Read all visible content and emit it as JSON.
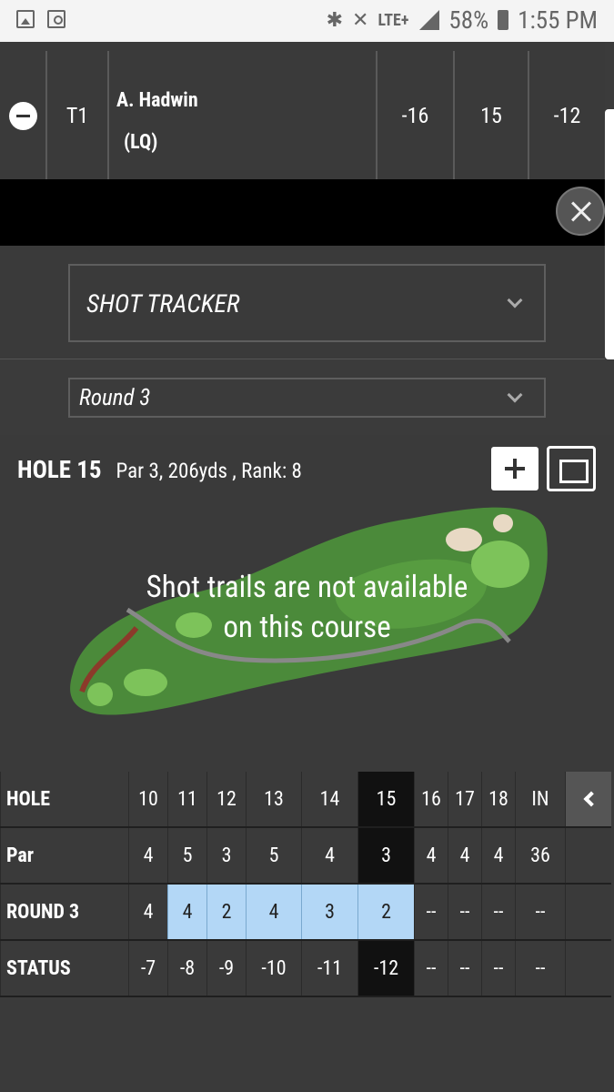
{
  "status_bar": {
    "signal_label": "LTE+",
    "battery": "58%",
    "time": "1:55 PM"
  },
  "leaderboard_row": {
    "position": "T1",
    "player_name": "A. Hadwin",
    "player_note": "(LQ)",
    "to_par": "-16",
    "thru": "15",
    "today": "-12"
  },
  "tracker": {
    "mode_select": "SHOT TRACKER",
    "round_select": "Round 3"
  },
  "hole": {
    "title": "HOLE 15",
    "info": "Par 3, 206yds , Rank: 8",
    "message_line1": "Shot trails are not available",
    "message_line2": "on this course"
  },
  "scorecard": {
    "labels": {
      "hole": "HOLE",
      "par": "Par",
      "round": "ROUND 3",
      "status": "STATUS"
    },
    "holes": [
      "10",
      "11",
      "12",
      "13",
      "14",
      "15",
      "16",
      "17",
      "18",
      "IN"
    ],
    "par": [
      "4",
      "5",
      "3",
      "5",
      "4",
      "3",
      "4",
      "4",
      "4",
      "36"
    ],
    "round": [
      "4",
      "4",
      "2",
      "4",
      "3",
      "2",
      "--",
      "--",
      "--",
      "--"
    ],
    "status": [
      "-7",
      "-8",
      "-9",
      "-10",
      "-11",
      "-12",
      "--",
      "--",
      "--",
      "--"
    ],
    "current_hole_index": 5,
    "under_par_color": "#b3d7f6"
  }
}
